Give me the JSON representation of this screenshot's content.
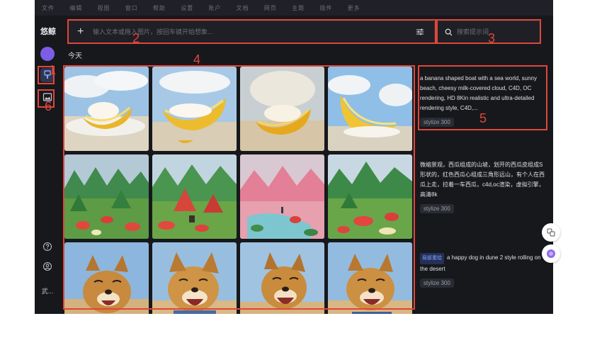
{
  "app": {
    "logo_text": "悠鲸",
    "top_strip_items": [
      "文件",
      "编辑",
      "视图",
      "窗口",
      "帮助",
      "设置",
      "账户",
      "文档",
      "网页",
      "主题",
      "插件",
      "更多"
    ],
    "user_initial": "",
    "user_label": "武..."
  },
  "prompt": {
    "placeholder": "输入文本或拖入图片，按回车键开始想象...",
    "value": ""
  },
  "search": {
    "placeholder": "搜索提示词",
    "value": ""
  },
  "section_title": "今天",
  "cards": [
    {
      "text": "a banana shaped boat with a sea world, sunny beach, cheesy milk-covered cloud, C4D, OC rendering, HD 8Kin realistic and ultra-detailed rendering style, C4D,...",
      "tag": "stylize 300"
    },
    {
      "text": "微缩景观，西瓜组成的山坡，划开的西瓜皮组成S形状的，红色西瓜心组成三角形远山，有个人在西瓜上走，拉着一车西瓜，c4d,oc渲染，虚拟引擎，高清8k",
      "tag": "stylize 300"
    },
    {
      "chip": "局部重绘",
      "text": "a happy dog in dune 2 style rolling on the desert",
      "tag": "stylize 300"
    }
  ],
  "annotations": [
    "1",
    "2",
    "3",
    "4",
    "5",
    "6"
  ],
  "icons": {
    "sidebar_active": "brush-icon",
    "sidebar_gallery": "image-icon",
    "help": "help-icon",
    "user": "user-icon",
    "prompt_add": "plus-icon",
    "prompt_settings": "sliders-icon",
    "search": "search-icon"
  },
  "colors": {
    "background": "#17181c",
    "accent": "#7c5de6",
    "annotation": "#e0463a"
  }
}
